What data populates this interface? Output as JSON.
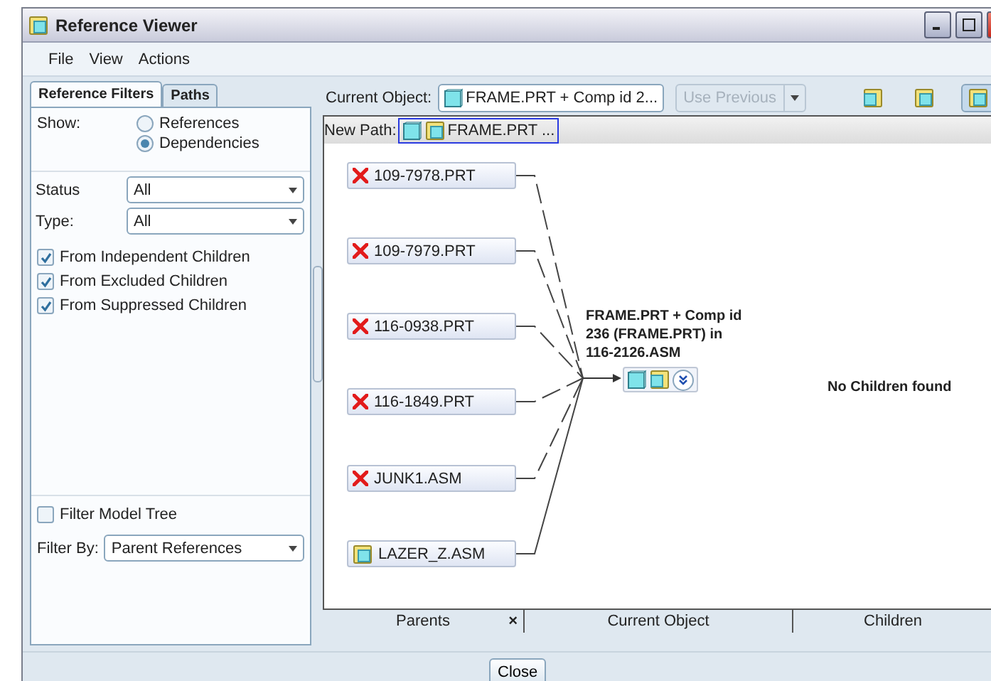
{
  "window": {
    "title": "Reference Viewer"
  },
  "menu": [
    "File",
    "View",
    "Actions"
  ],
  "left_tabs": [
    {
      "label": "Reference Filters",
      "selected": true
    },
    {
      "label": "Paths",
      "selected": false
    }
  ],
  "show": {
    "label": "Show:",
    "options": [
      {
        "label": "References",
        "selected": false
      },
      {
        "label": "Dependencies",
        "selected": true
      }
    ]
  },
  "filters": [
    {
      "label": "Status",
      "value": "All"
    },
    {
      "label": "Type:",
      "value": "All"
    }
  ],
  "checkboxes": [
    {
      "label": "From Independent Children",
      "checked": true
    },
    {
      "label": "From Excluded Children",
      "checked": true
    },
    {
      "label": "From Suppressed Children",
      "checked": true
    }
  ],
  "filter_model_tree": {
    "label": "Filter Model Tree",
    "checked": false
  },
  "filter_by": {
    "label": "Filter By:",
    "value": "Parent References"
  },
  "current_object": {
    "label": "Current Object:",
    "value": "FRAME.PRT + Comp id 2...",
    "use_previous": {
      "label": "Use Previous",
      "disabled": true
    }
  },
  "new_path": {
    "label": "New Path:",
    "value": "FRAME.PRT ..."
  },
  "parents": [
    {
      "name": "109-7978.PRT",
      "kind": "missing",
      "dashed": true
    },
    {
      "name": "109-7979.PRT",
      "kind": "missing",
      "dashed": true
    },
    {
      "name": "116-0938.PRT",
      "kind": "missing",
      "dashed": true
    },
    {
      "name": "116-1849.PRT",
      "kind": "missing",
      "dashed": true
    },
    {
      "name": "JUNK1.ASM",
      "kind": "missing",
      "dashed": true
    },
    {
      "name": "LAZER_Z.ASM",
      "kind": "assembly",
      "dashed": false
    }
  ],
  "current": {
    "label": "FRAME.PRT + Comp id 236 (FRAME.PRT) in 116-2126.ASM"
  },
  "children_message": "No Children found",
  "columns": [
    {
      "label": "Parents",
      "close": "×"
    },
    {
      "label": "Current Object"
    },
    {
      "label": "Children"
    }
  ],
  "buttons": [
    "Close"
  ]
}
